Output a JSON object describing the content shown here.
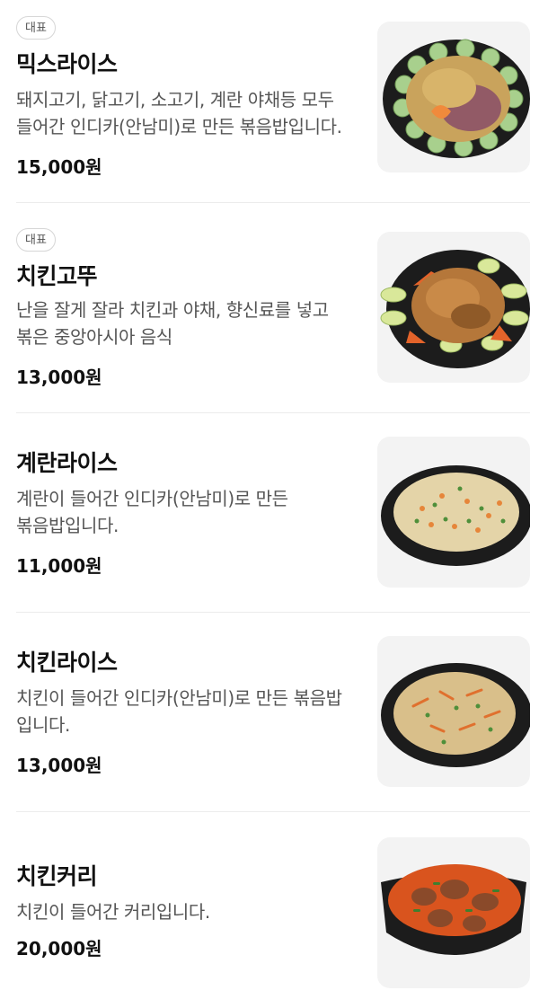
{
  "menu": {
    "items": [
      {
        "badge": "대표",
        "name": "믹스라이스",
        "description": "돼지고기, 닭고기, 소고기, 계란 야채등 모두 들어간 인디카(안남미)로 만든 볶음밥입니다.",
        "price": "15,000원",
        "dish_icon": "mix-rice-salad-plate",
        "colors": {
          "plate": "#1c1c1c",
          "food": "#c9a35c",
          "accent": "#7a3b6b",
          "garnish": "#a8d08d",
          "carrot": "#f08a3c"
        }
      },
      {
        "badge": "대표",
        "name": "치킨고뚜",
        "description": "난을 잘게 잘라 치킨과 야채, 향신료를 넣고 볶은 중앙아시아 음식",
        "price": "13,000원",
        "dish_icon": "chicken-kottu-plate",
        "colors": {
          "plate": "#1c1c1c",
          "food": "#b5773a",
          "accent": "#e3632a",
          "garnish": "#d9e89a",
          "carrot": "#f07a2c"
        }
      },
      {
        "badge": "",
        "name": "계란라이스",
        "description": "계란이 들어간 인디카(안남미)로 만든 볶음밥입니다.",
        "price": "11,000원",
        "dish_icon": "egg-fried-rice-plate",
        "colors": {
          "plate": "#1c1c1c",
          "food": "#e4d4a8",
          "accent": "#e6863a",
          "garnish": "#4f8f3a",
          "carrot": "#e6863a"
        }
      },
      {
        "badge": "",
        "name": "치킨라이스",
        "description": "치킨이 들어간 인디카(안남미)로 만든 볶음밥 입니다.",
        "price": "13,000원",
        "dish_icon": "chicken-fried-rice-plate",
        "colors": {
          "plate": "#1c1c1c",
          "food": "#d9bf8a",
          "accent": "#e0702e",
          "garnish": "#4f8f3a",
          "carrot": "#e0702e"
        }
      },
      {
        "badge": "",
        "name": "치킨커리",
        "description": "치킨이 들어간 커리입니다.",
        "price": "20,000원",
        "dish_icon": "chicken-curry-bowl",
        "colors": {
          "plate": "#1c1c1c",
          "food": "#d9541e",
          "accent": "#8a4a2a",
          "garnish": "#3f7f2f",
          "carrot": "#c4381a"
        }
      }
    ]
  }
}
